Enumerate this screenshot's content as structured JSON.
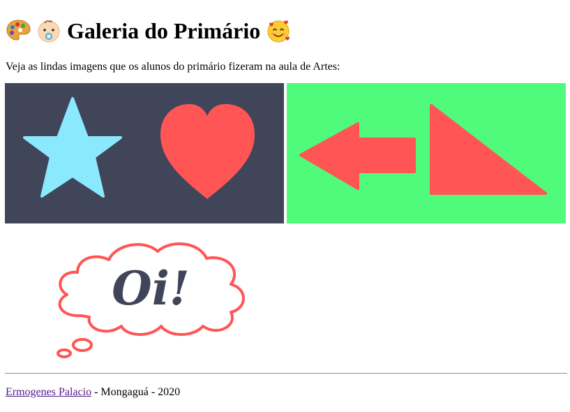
{
  "page": {
    "title": "Galeria do Primário",
    "emojis": [
      "palette-icon",
      "baby-icon",
      "smiling-face-with-hearts-icon"
    ]
  },
  "intro": "Veja as lindas imagens que os alunos do primário fizeram na aula de Artes:",
  "gallery": {
    "images": [
      {
        "subject": "estrela e coração",
        "background": "#41455a",
        "colors": [
          "#8be9fd",
          "#ff5555"
        ]
      },
      {
        "subject": "seta e triângulo",
        "background": "#50fa7b",
        "colors": [
          "#ff5555"
        ]
      }
    ]
  },
  "thought_bubble": {
    "text": "Oi!",
    "outline_color": "#ff5555",
    "text_color": "#41455a"
  },
  "footer": {
    "author_link": "Ermogenes Palacio",
    "rest": " - Mongaguá - 2020"
  }
}
